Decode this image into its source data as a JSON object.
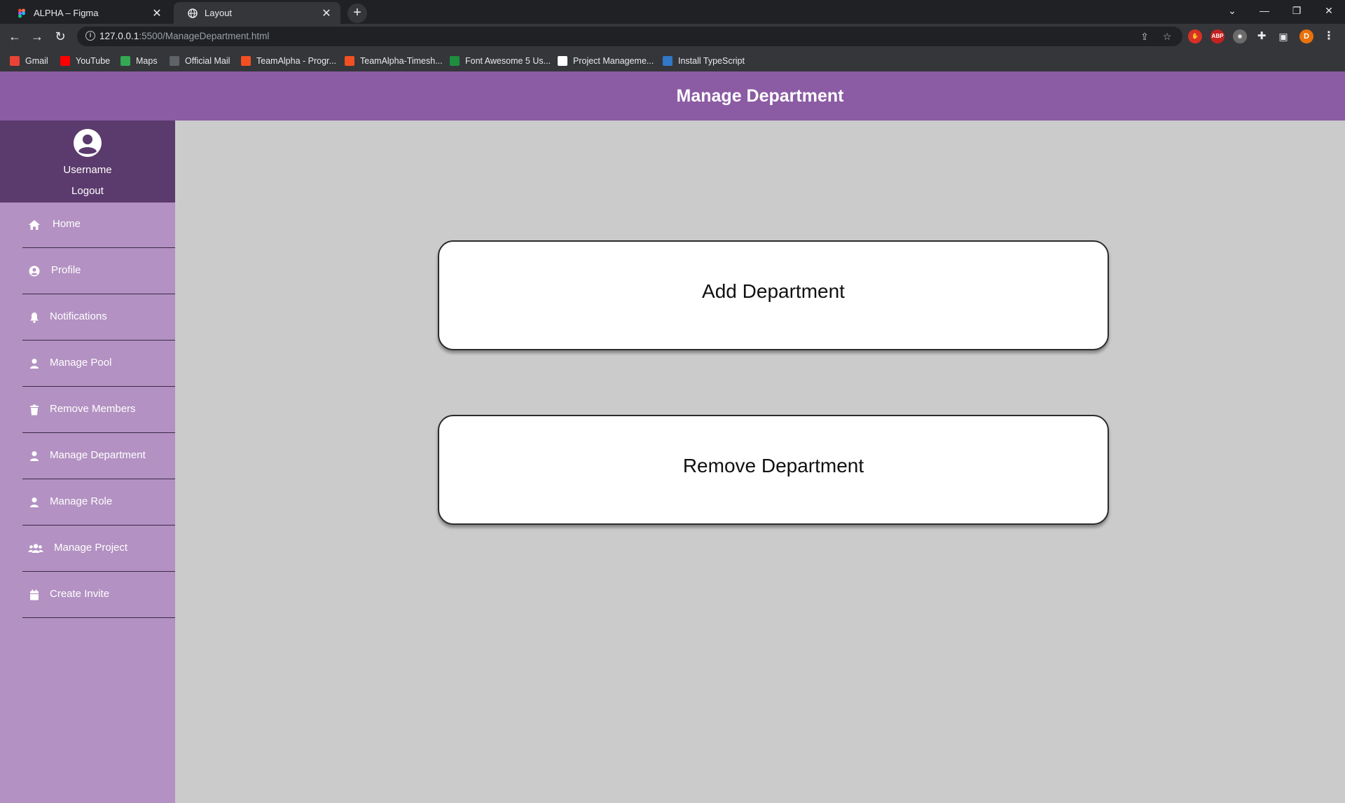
{
  "browser": {
    "tabs": [
      {
        "title": "ALPHA – Figma",
        "active": false
      },
      {
        "title": "Layout",
        "active": true
      }
    ],
    "address": {
      "host": "127.0.0.1",
      "rest": ":5500/ManageDepartment.html"
    },
    "extensions": [
      "ABP"
    ],
    "profile_initial": "D",
    "bookmarks": [
      {
        "label": "Gmail",
        "icon_color": "#ea4335"
      },
      {
        "label": "YouTube",
        "icon_color": "#ff0000"
      },
      {
        "label": "Maps",
        "icon_color": "#34a853"
      },
      {
        "label": "Official Mail",
        "icon_color": "#5f6368"
      },
      {
        "label": "TeamAlpha - Progr...",
        "icon_color": "#f25022"
      },
      {
        "label": "TeamAlpha-Timesh...",
        "icon_color": "#f25022"
      },
      {
        "label": "Font Awesome 5 Us...",
        "icon_color": "#1e8e3e"
      },
      {
        "label": "Project Manageme...",
        "icon_color": "#ffffff"
      },
      {
        "label": "Install TypeScript",
        "icon_color": "#3178c6"
      }
    ]
  },
  "header": {
    "title": "Manage Department"
  },
  "sidebar": {
    "username": "Username",
    "logout": "Logout",
    "items": [
      {
        "label": "Home",
        "icon": "home-icon"
      },
      {
        "label": "Profile",
        "icon": "user-circle-icon"
      },
      {
        "label": "Notifications",
        "icon": "bell-icon"
      },
      {
        "label": "Manage Pool",
        "icon": "user-icon"
      },
      {
        "label": "Remove Members",
        "icon": "trash-icon"
      },
      {
        "label": "Manage Department",
        "icon": "user-icon"
      },
      {
        "label": "Manage Role",
        "icon": "user-icon"
      },
      {
        "label": "Manage Project",
        "icon": "users-icon"
      },
      {
        "label": "Create Invite",
        "icon": "calendar-icon"
      }
    ]
  },
  "main": {
    "add_label": "Add Department",
    "remove_label": "Remove Department"
  },
  "colors": {
    "header": "#8b5ba4",
    "sidebar": "#b391c2",
    "user_box": "#5b3a6d",
    "content_bg": "#cbcbcb"
  }
}
